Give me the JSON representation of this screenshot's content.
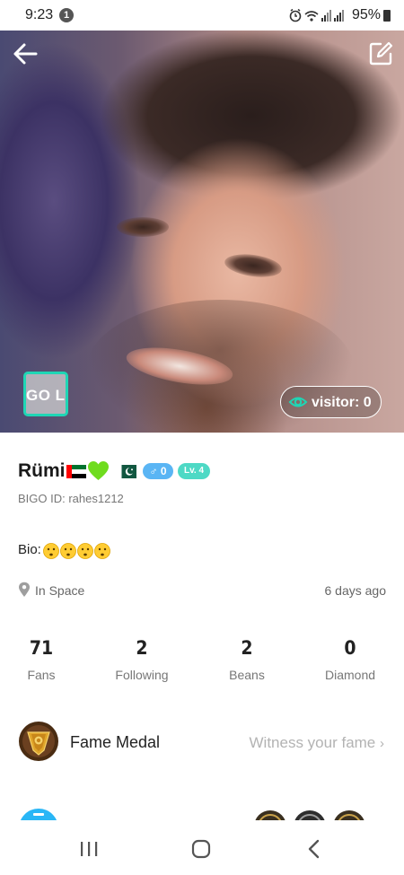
{
  "status_bar": {
    "time": "9:23",
    "notification_count": "1",
    "battery": "95%",
    "icons": [
      "alarm-icon",
      "wifi-icon",
      "signal-icon",
      "signal-icon",
      "battery-icon"
    ]
  },
  "header": {
    "back_icon": "arrow-left-icon",
    "edit_icon": "edit-icon"
  },
  "hero": {
    "go_live_label": "GO LIVE",
    "visitor_label": "visitor: 0",
    "visitor_icon": "eye-icon"
  },
  "profile": {
    "name": "Rümi",
    "name_decorations": [
      "uae-flag-icon",
      "green-heart-icon",
      "pakistan-flag-icon"
    ],
    "gender_badge": "0",
    "gender_icon": "male-icon",
    "level_badge": "Lv. 4",
    "bigo_id": "BIGO ID: rahes1212",
    "bio_label": "Bio:",
    "bio_emojis": [
      "hushed-face-emoji",
      "hushed-face-emoji",
      "hushed-face-emoji",
      "hushed-face-emoji"
    ],
    "location": "In Space",
    "location_icon": "pin-icon",
    "last_seen": "6 days ago"
  },
  "stats": [
    {
      "value": "71",
      "label": "Fans"
    },
    {
      "value": "2",
      "label": "Following"
    },
    {
      "value": "2",
      "label": "Beans"
    },
    {
      "value": "0",
      "label": "Diamond"
    }
  ],
  "fame": {
    "label": "Fame Medal",
    "link_text": "Witness your fame",
    "link_icon": "chevron-right-icon",
    "medal_icon": "medal-icon"
  },
  "nav_bar": {
    "recent_icon": "recent-apps-icon",
    "home_icon": "home-icon",
    "back_icon": "back-icon"
  },
  "colors": {
    "accent_teal": "#1fd6b5",
    "gender_blue": "#5ab5f4",
    "level_teal": "#4ed9c5",
    "muted_text": "#777777",
    "link_gray": "#b3b3b3"
  }
}
